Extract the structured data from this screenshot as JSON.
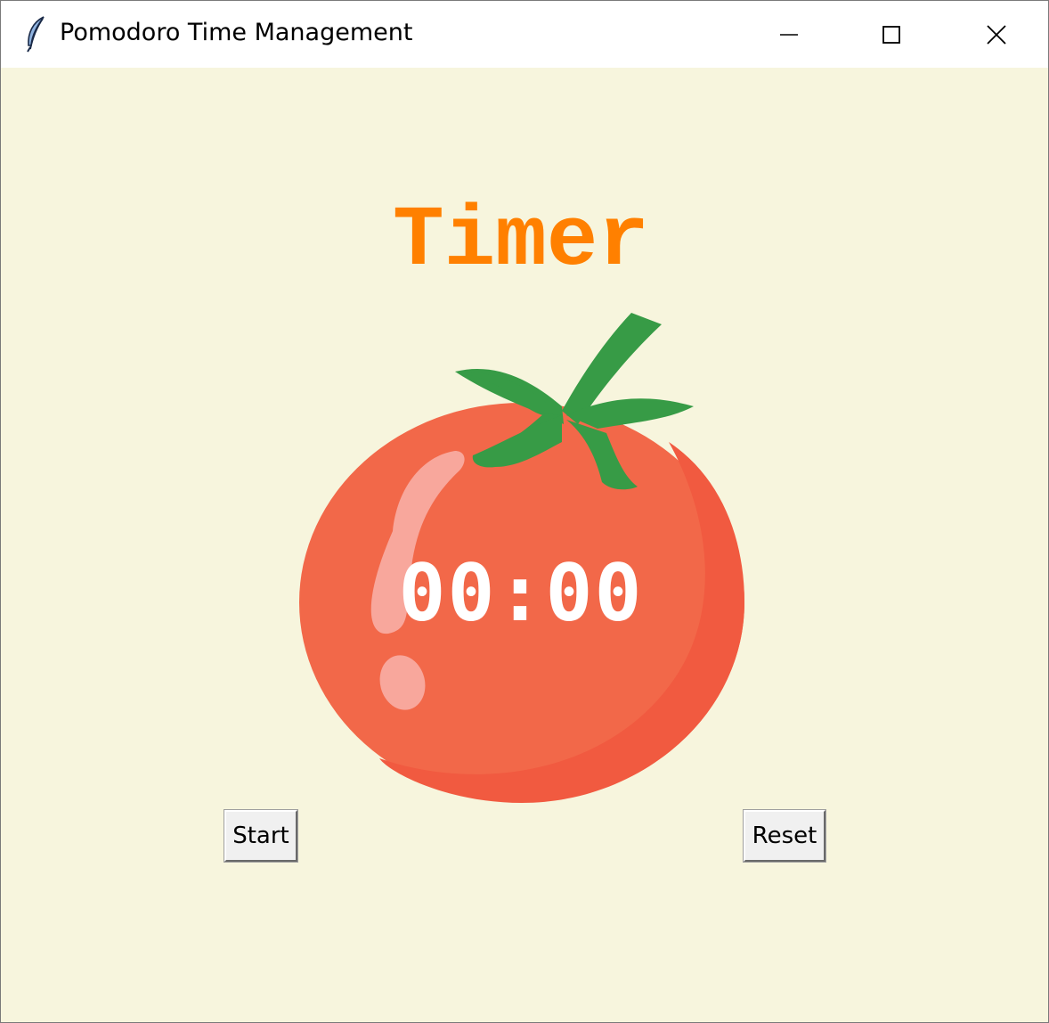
{
  "window": {
    "title": "Pomodoro Time Management",
    "app_icon": "feather-icon",
    "controls": {
      "minimize": "minimize-icon",
      "maximize": "maximize-icon",
      "close": "close-icon"
    }
  },
  "main": {
    "heading": "Timer",
    "countdown": "00:00",
    "image": "tomato-icon",
    "buttons": {
      "start": "Start",
      "reset": "Reset"
    }
  },
  "colors": {
    "background": "#f7f5dd",
    "heading": "#ff8000",
    "tomato": "#f26849",
    "tomato_shade": "#f15a40",
    "leaf": "#379b46",
    "highlight": "#f8a79c",
    "countdown": "#ffffff"
  }
}
